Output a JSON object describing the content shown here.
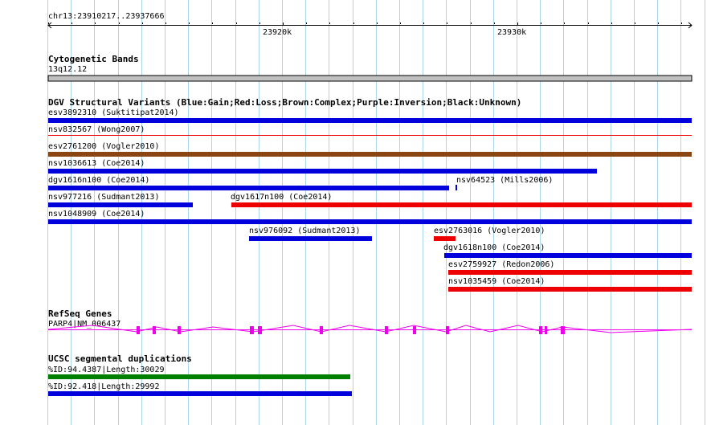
{
  "ruler": {
    "coordinates": "chr13:23910217..23937666",
    "tick_labels": [
      "23920k",
      "23930k"
    ]
  },
  "cytoband": {
    "title": "Cytogenetic Bands",
    "band": "13q12.12",
    "color": "#c0c0c0"
  },
  "dgv": {
    "title": "DGV Structural Variants (Blue:Gain;Red:Loss;Brown:Complex;Purple:Inversion;Black:Unknown)",
    "colors": {
      "gain": "#0000dd",
      "loss": "#ee0000",
      "complex": "#8b4513"
    },
    "variants": [
      {
        "label": "esv3892310 (Suktitipat2014)",
        "type": "gain"
      },
      {
        "label": "nsv832567 (Wong2007)",
        "type": "loss"
      },
      {
        "label": "esv2761200 (Vogler2010)",
        "type": "complex"
      },
      {
        "label": "nsv1036613 (Coe2014)",
        "type": "gain"
      },
      {
        "label": "dgv1616n100 (Coe2014)",
        "type": "gain"
      },
      {
        "label": "nsv64523 (Mills2006)",
        "type": "gain"
      },
      {
        "label": "nsv977216 (Sudmant2013)",
        "type": "gain"
      },
      {
        "label": "dgv1617n100 (Coe2014)",
        "type": "loss"
      },
      {
        "label": "nsv1048909 (Coe2014)",
        "type": "gain"
      },
      {
        "label": "nsv976092 (Sudmant2013)",
        "type": "gain"
      },
      {
        "label": "esv2763016 (Vogler2010)",
        "type": "loss"
      },
      {
        "label": "dgv1618n100 (Coe2014)",
        "type": "gain"
      },
      {
        "label": "esv2759927 (Redon2006)",
        "type": "loss"
      },
      {
        "label": "nsv1035459 (Coe2014)",
        "type": "loss"
      }
    ]
  },
  "refseq": {
    "title": "RefSeq Genes",
    "gene": "PARP4|NM_006437",
    "color": "#ee00ee"
  },
  "segdups": {
    "title": "UCSC segmental duplications",
    "items": [
      {
        "label": "%ID:94.4387|Length:30029",
        "color": "#008000"
      },
      {
        "label": "%ID:92.418|Length:29992",
        "color": "#0000dd"
      }
    ]
  }
}
